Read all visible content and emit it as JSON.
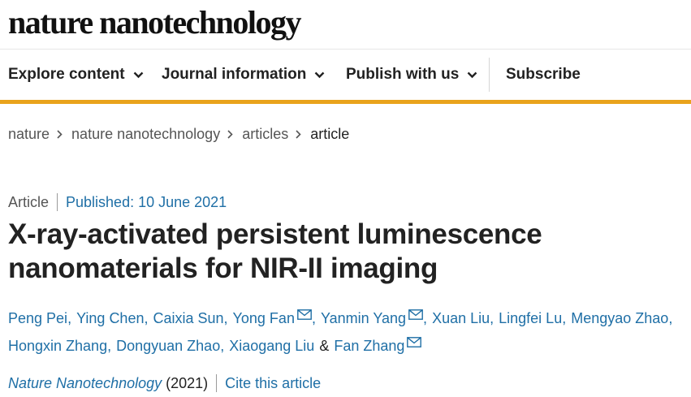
{
  "site": {
    "logo": "nature nanotechnology"
  },
  "nav": {
    "items": [
      {
        "label": "Explore content"
      },
      {
        "label": "Journal information"
      },
      {
        "label": "Publish with us"
      }
    ],
    "subscribe": "Subscribe"
  },
  "breadcrumb": [
    "nature",
    "nature nanotechnology",
    "articles",
    "article"
  ],
  "article": {
    "type": "Article",
    "published": "Published: 10 June 2021",
    "title_lines": [
      "X-ray-activated persistent luminescence",
      "nanomaterials for NIR-II imaging"
    ],
    "authors": {
      "line1": [
        "Peng Pei",
        "Ying Chen",
        "Caixia Sun",
        "Yong Fan",
        "Yanmin Yang",
        "Xuan Liu",
        "Lingfei Lu",
        "Mengyao Zhao"
      ],
      "line2": [
        "Hongxin Zhang",
        "Dongyuan Zhao",
        "Xiaogang Liu",
        "Fan Zhang"
      ],
      "conjunction": "&",
      "separator": ","
    },
    "journal": "Nature Nanotechnology",
    "year": "(2021)",
    "cite": "Cite this article"
  },
  "icons": {
    "chevron": "chevron-down-icon",
    "breadcrumb": "chevron-right-icon",
    "mail": "mail-icon"
  },
  "colors": {
    "accent": "#e9a31c",
    "link": "#1f6fa6",
    "text": "#222222"
  }
}
